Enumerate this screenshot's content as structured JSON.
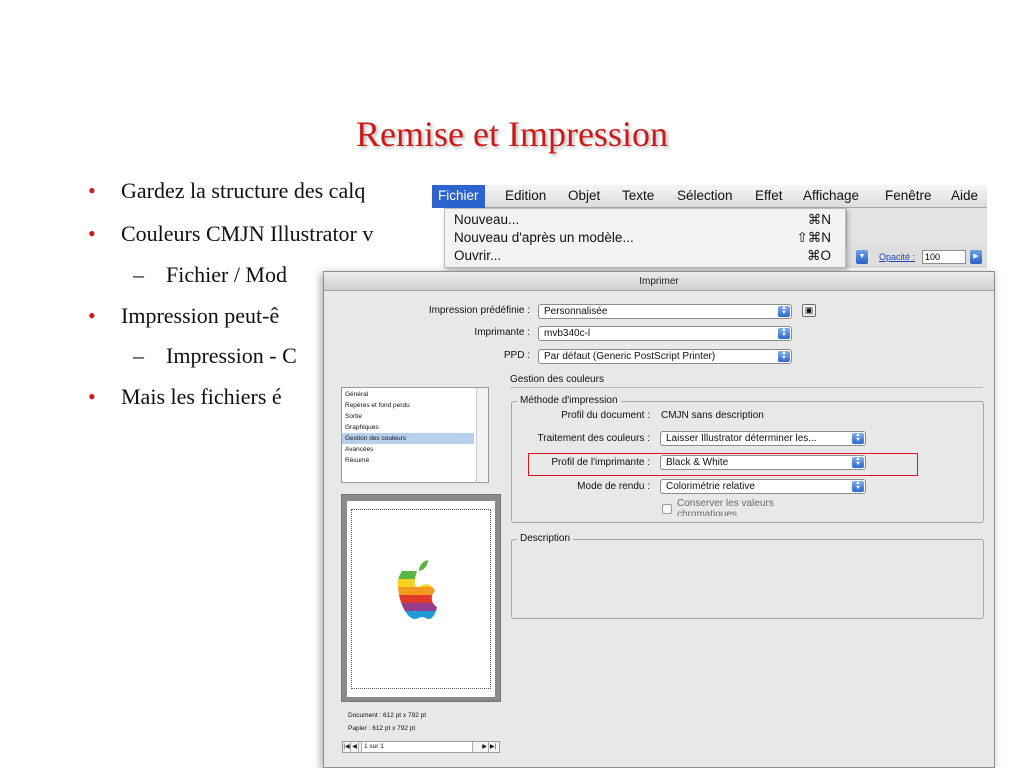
{
  "slide": {
    "title": "Remise et Impression",
    "bullets": [
      "Gardez la structure des calq",
      "Couleurs CMJN Illustrator v",
      "Impression peut-ê",
      "Mais les fichiers é"
    ],
    "subbullets": [
      "Fichier / Mod",
      "Impression - C"
    ],
    "bullet_symbol": "•",
    "dash_symbol": "–",
    "title_color": "#cc1a1a"
  },
  "menubar": {
    "items": [
      "Fichier",
      "Edition",
      "Objet",
      "Texte",
      "Sélection",
      "Effet",
      "Affichage",
      "Fenêtre",
      "Aide"
    ],
    "active": "Fichier",
    "active_color": "#2d63cf"
  },
  "file_menu": {
    "items": [
      {
        "label": "Nouveau...",
        "shortcut": "⌘N"
      },
      {
        "label": "Nouveau d'après un modèle...",
        "shortcut": "⇧⌘N"
      },
      {
        "label": "Ouvrir...",
        "shortcut": "⌘O"
      }
    ]
  },
  "toolbar_bg": {
    "opacity_label": "Opacité :",
    "opacity_value": "100"
  },
  "print_dialog": {
    "title": "Imprimer",
    "preset_label": "Impression prédéfinie :",
    "preset_value": "Personnalisée",
    "printer_label": "Imprimante :",
    "printer_value": "mvb340c-l",
    "ppd_label": "PPD :",
    "ppd_value": "Par défaut (Generic PostScript Printer)",
    "categories": [
      "Général",
      "Repères et fond perdu",
      "Sortie",
      "Graphiques",
      "Gestion des couleurs",
      "Avancées",
      "Résumé"
    ],
    "selected_category": "Gestion des couleurs",
    "color_section_title": "Gestion des couleurs",
    "method_group_title": "Méthode d'impression",
    "doc_profile_label": "Profil du document :",
    "doc_profile_value": "CMJN sans description",
    "color_handling_label": "Traitement des couleurs :",
    "color_handling_value": "Laisser Illustrator déterminer les...",
    "printer_profile_label": "Profil de l'imprimante :",
    "printer_profile_value": "Black & White",
    "render_intent_label": "Mode de rendu :",
    "render_intent_value": "Colorimétrie relative",
    "preserve_values_label": "Conserver les valeurs chromatiques",
    "description_group_title": "Description",
    "document_size": "Document : 612 pt x 792 pt",
    "paper_size": "Papier : 612 pt x 792 pt",
    "page_nav_value": "1 sur 1",
    "highlight_color": "#d8181c"
  }
}
